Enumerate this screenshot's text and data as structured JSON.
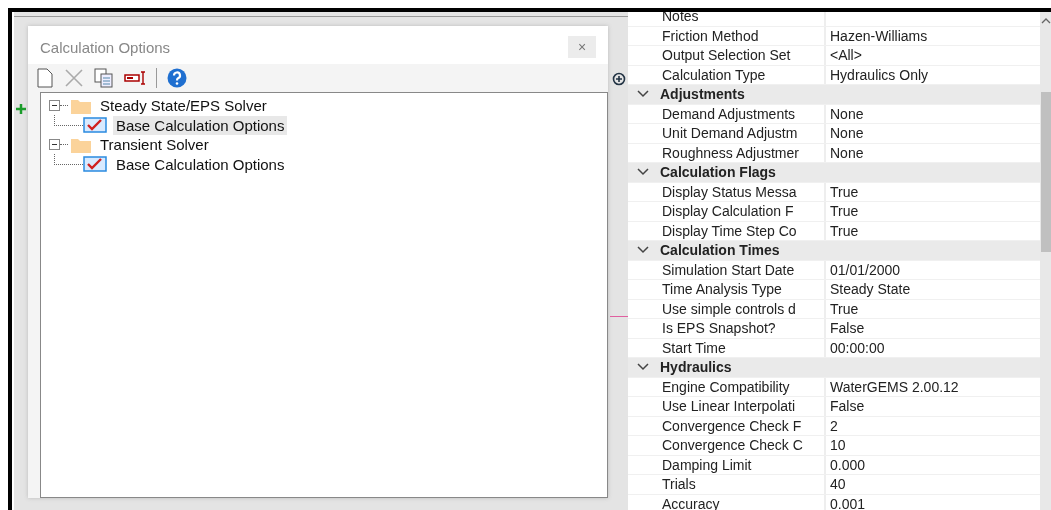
{
  "dialog": {
    "title": "Calculation Options",
    "close_glyph": "×",
    "tree": [
      {
        "label": "Steady State/EPS Solver",
        "expanded": true,
        "children": [
          {
            "label": "Base Calculation Options",
            "selected": true
          }
        ]
      },
      {
        "label": "Transient Solver",
        "expanded": true,
        "children": [
          {
            "label": "Base Calculation Options",
            "selected": false
          }
        ]
      }
    ]
  },
  "properties": [
    {
      "kind": "property",
      "name": "Notes"
    },
    {
      "kind": "property",
      "name": "Friction Method",
      "value": "Hazen-Williams"
    },
    {
      "kind": "property",
      "name": "Output Selection Set",
      "value": "<All>"
    },
    {
      "kind": "property",
      "name": "Calculation Type",
      "value": "Hydraulics Only"
    },
    {
      "kind": "category",
      "name": "Adjustments",
      "expanded": true
    },
    {
      "kind": "property",
      "name": "Demand Adjustments",
      "value": "None"
    },
    {
      "kind": "property",
      "name": "Unit Demand Adjustm",
      "value": "None"
    },
    {
      "kind": "property",
      "name": "Roughness Adjustmer",
      "value": "None"
    },
    {
      "kind": "category",
      "name": "Calculation Flags",
      "expanded": true
    },
    {
      "kind": "property",
      "name": "Display Status Messa",
      "value": "True"
    },
    {
      "kind": "property",
      "name": "Display Calculation F",
      "value": "True"
    },
    {
      "kind": "property",
      "name": "Display Time Step Co",
      "value": "True"
    },
    {
      "kind": "category",
      "name": "Calculation Times",
      "expanded": true
    },
    {
      "kind": "property",
      "name": "Simulation Start Date",
      "value": "01/01/2000"
    },
    {
      "kind": "property",
      "name": "Time Analysis Type",
      "value": "Steady State"
    },
    {
      "kind": "property",
      "name": "Use simple controls d",
      "value": "True"
    },
    {
      "kind": "property",
      "name": "Is EPS Snapshot?",
      "value": "False"
    },
    {
      "kind": "property",
      "name": "Start Time",
      "value": "00:00:00"
    },
    {
      "kind": "category",
      "name": "Hydraulics",
      "expanded": true
    },
    {
      "kind": "property",
      "name": "Engine Compatibility",
      "value": "WaterGEMS 2.00.12"
    },
    {
      "kind": "property",
      "name": "Use Linear Interpolati",
      "value": "False"
    },
    {
      "kind": "property",
      "name": "Convergence Check F",
      "value": "2"
    },
    {
      "kind": "property",
      "name": "Convergence Check C",
      "value": "10"
    },
    {
      "kind": "property",
      "name": "Damping Limit",
      "value": "0.000"
    },
    {
      "kind": "property",
      "name": "Trials",
      "value": "40"
    },
    {
      "kind": "property",
      "name": "Accuracy",
      "value": "0.001"
    }
  ]
}
